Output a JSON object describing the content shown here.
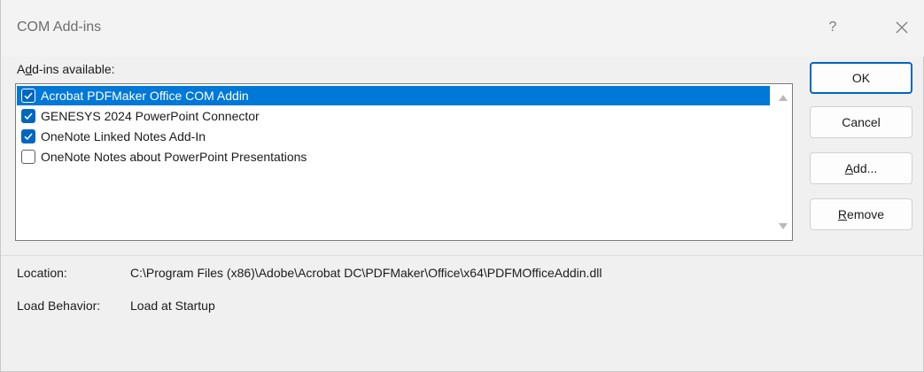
{
  "window": {
    "title": "COM Add-ins",
    "help_glyph": "?",
    "close_glyph": "✕"
  },
  "addins": {
    "label_before": "A",
    "label_accel": "d",
    "label_after": "d-ins available:",
    "items": [
      {
        "label": "Acrobat PDFMaker Office COM Addin",
        "checked": true,
        "selected": true
      },
      {
        "label": "GENESYS 2024 PowerPoint Connector",
        "checked": true,
        "selected": false
      },
      {
        "label": "OneNote Linked Notes Add-In",
        "checked": true,
        "selected": false
      },
      {
        "label": "OneNote Notes about PowerPoint Presentations",
        "checked": false,
        "selected": false
      }
    ]
  },
  "buttons": {
    "ok": "OK",
    "cancel": "Cancel",
    "add_accel": "A",
    "add_rest": "dd...",
    "remove_accel": "R",
    "remove_rest": "emove"
  },
  "details": {
    "location_label": "Location:",
    "location_value": "C:\\Program Files (x86)\\Adobe\\Acrobat DC\\PDFMaker\\Office\\x64\\PDFMOfficeAddin.dll",
    "load_behavior_label": "Load Behavior:",
    "load_behavior_value": "Load at Startup"
  },
  "colors": {
    "selection": "#0078d7",
    "checkbox_checked": "#0067c0",
    "default_button_border": "#0067c0"
  },
  "icons": {
    "help": "help-icon",
    "close": "close-icon",
    "check": "checkmark-icon",
    "scroll_up": "scroll-up-arrow-icon",
    "scroll_down": "scroll-down-arrow-icon"
  }
}
